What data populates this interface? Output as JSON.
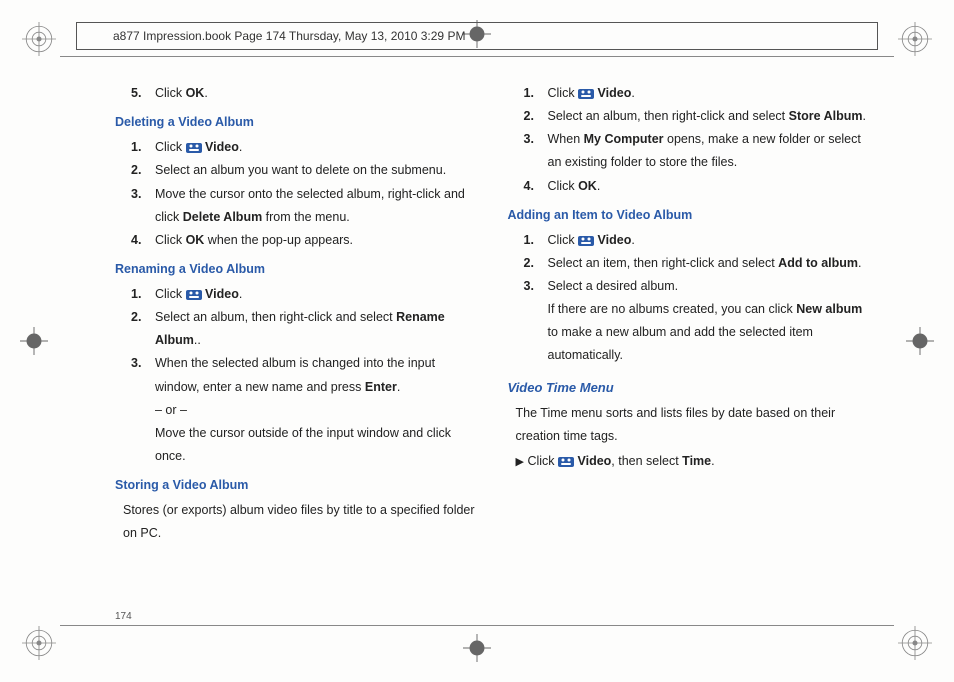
{
  "header": "a877 Impression.book  Page 174  Thursday, May 13, 2010  3:29 PM",
  "pageNumber": "174",
  "videoLabel": "Video",
  "left": {
    "step5": {
      "num": "5.",
      "pre": "Click ",
      "bold": "OK",
      "post": "."
    },
    "sec1": {
      "title": "Deleting a Video Album",
      "s1": {
        "num": "1.",
        "pre": "Click ",
        "post": "."
      },
      "s2": {
        "num": "2.",
        "text": "Select an album you want to delete on the submenu."
      },
      "s3": {
        "num": "3.",
        "pre": "Move the cursor onto the selected album, right-click and click ",
        "bold": "Delete Album",
        "post": " from the menu."
      },
      "s4": {
        "num": "4.",
        "pre": "Click ",
        "bold": "OK",
        "post": " when the pop-up appears."
      }
    },
    "sec2": {
      "title": "Renaming a Video Album",
      "s1": {
        "num": "1.",
        "pre": "Click ",
        "post": "."
      },
      "s2": {
        "num": "2.",
        "pre": "Select an album, then right-click and select ",
        "bold": "Rename Album",
        "post": ".."
      },
      "s3": {
        "num": "3.",
        "pre": "When the selected album is changed into the input window, enter a new name and press ",
        "bold": "Enter",
        "post": "."
      },
      "or": "– or –",
      "s3b": "Move the cursor outside of the input window and click once."
    },
    "sec3": {
      "title": "Storing a Video Album",
      "desc": "Stores (or exports) album video files by title to a specified folder on PC."
    }
  },
  "right": {
    "s1": {
      "num": "1.",
      "pre": "Click ",
      "post": "."
    },
    "s2": {
      "num": "2.",
      "pre": "Select an album, then right-click and select ",
      "bold": "Store Album",
      "post": "."
    },
    "s3": {
      "num": "3.",
      "pre": "When ",
      "bold": "My Computer",
      "post": " opens, make a new folder or select an existing folder to store the files."
    },
    "s4": {
      "num": "4.",
      "pre": "Click ",
      "bold": "OK",
      "post": "."
    },
    "sec1": {
      "title": "Adding an Item to Video Album",
      "s1": {
        "num": "1.",
        "pre": "Click ",
        "post": "."
      },
      "s2": {
        "num": "2.",
        "pre": "Select an item, then right-click and select ",
        "bold": "Add to album",
        "post": "."
      },
      "s3": {
        "num": "3.",
        "text": "Select a desired album."
      },
      "s3b": {
        "pre": "If there are no albums created, you can click ",
        "bold": "New album",
        "post": " to make a new album and add the selected item automatically."
      }
    },
    "sec2": {
      "title": "Video Time Menu",
      "desc": "The Time menu sorts and lists files by date based on their creation time tags.",
      "line": {
        "arrow": "▶",
        "pre": " Click ",
        "mid": ", then select ",
        "bold2": "Time",
        "post": "."
      }
    }
  }
}
